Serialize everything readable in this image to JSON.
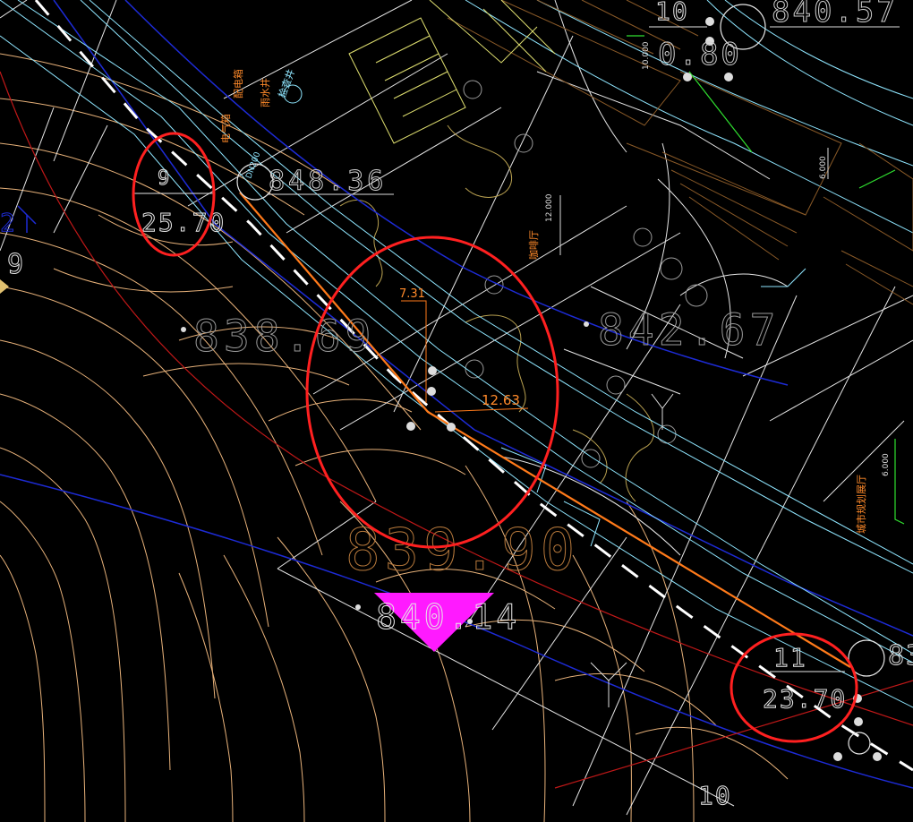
{
  "colors": {
    "background": "#000000",
    "contour": "#e8b27a",
    "contour_dark": "#b97a3c",
    "road_white": "#ffffff",
    "road_dash": "#ffffff",
    "cyan": "#8fe6ff",
    "blue": "#1d2bd6",
    "red_line": "#d01818",
    "orange": "#ff7a1a",
    "yellow": "#e0e070",
    "brown": "#8a5a28",
    "green": "#30e030",
    "magenta": "#ff1aff",
    "annotation_red": "#ff2020",
    "elev_text": "#aaaaaa",
    "label_white": "#dddddd",
    "orange_text": "#ff8a2a"
  },
  "elevations": {
    "top_right": "840.57",
    "top_right_partial": "0.80",
    "road_left": "848.36",
    "center": "842.67",
    "left_mid": "838.69",
    "large_center": "839.90",
    "triangle": "840.14"
  },
  "stations": {
    "left_top": "9",
    "left_bottom": "25.70",
    "right_top": "11",
    "right_bottom": "23.70",
    "top_number": "10",
    "bottom_number": "10",
    "right_edge": "83"
  },
  "dimensions": {
    "pipe_a": "7.31",
    "pipe_b": "12.63",
    "v_dim_1": "12.000",
    "v_dim_2": "6.000",
    "v_dim_3": "6.000",
    "v_dim_4": "10.000"
  },
  "labels": {
    "vertical_cn_1": "咖啡厅",
    "vertical_cn_2": "城市规划展厅",
    "left_edge_9": "9",
    "left_edge_2": "2"
  }
}
